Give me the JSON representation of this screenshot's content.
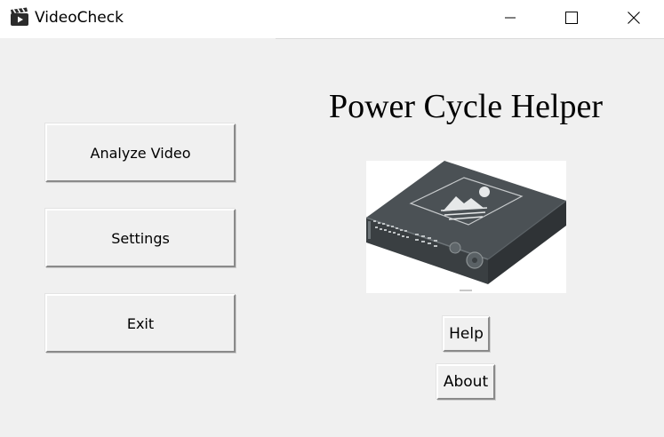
{
  "window": {
    "title": "VideoCheck",
    "app_icon": "clapperboard-icon",
    "controls": [
      "minimize-icon",
      "maximize-icon",
      "close-icon"
    ]
  },
  "menu": {
    "analyze_label": "Analyze Video",
    "settings_label": "Settings",
    "exit_label": "Exit"
  },
  "main": {
    "heading": "Power Cycle Helper",
    "device_image": "dvr-device-illustration",
    "help_label": "Help",
    "about_label": "About"
  }
}
